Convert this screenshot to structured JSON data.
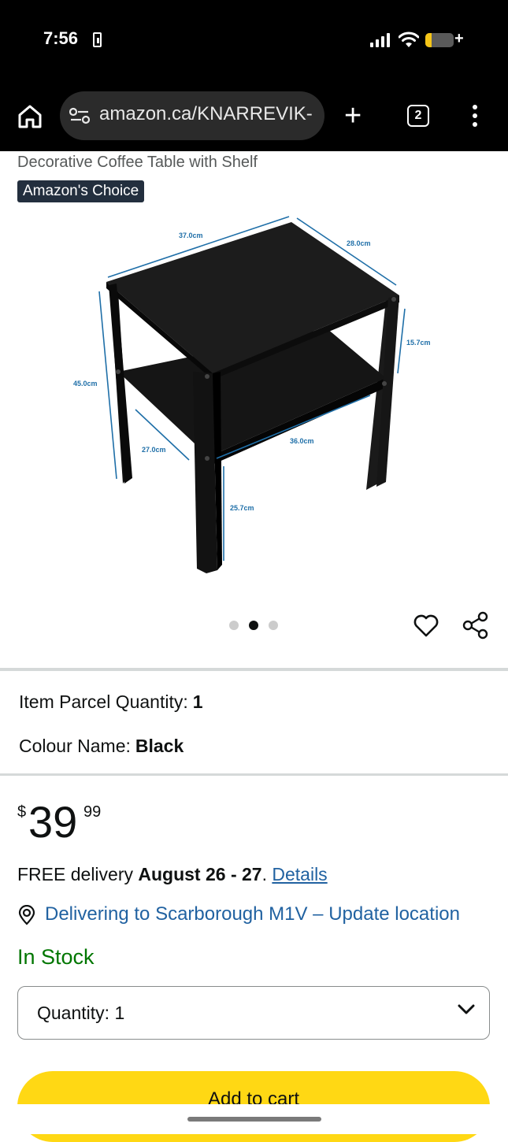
{
  "status_bar": {
    "time": "7:56",
    "battery_level": 0.22
  },
  "browser": {
    "url": "amazon.ca/KNARREVIK-",
    "tab_count": "2",
    "icons": [
      "home-icon",
      "site-settings-icon",
      "new-tab-icon",
      "tabs-icon",
      "more-menu-icon"
    ]
  },
  "product": {
    "title_fragment": "Decorative Coffee Table with Shelf",
    "badge": "Amazon's Choice",
    "image": {
      "dimensions": {
        "top_width": "37.0cm",
        "top_depth": "28.0cm",
        "shelf_gap": "15.7cm",
        "height": "45.0cm",
        "shelf_depth": "27.0cm",
        "shelf_width": "36.0cm",
        "leg_clearance": "25.7cm"
      }
    },
    "carousel": {
      "count": 3,
      "active_index": 1
    }
  },
  "attributes": [
    {
      "label": "Item Parcel Quantity:",
      "value": "1"
    },
    {
      "label": "Colour Name:",
      "value": "Black"
    }
  ],
  "price": {
    "symbol": "$",
    "whole": "39",
    "fraction": "99"
  },
  "delivery": {
    "prefix": "FREE delivery",
    "dates": "August 26 - 27",
    "suffix": ".",
    "details_link": "Details"
  },
  "location": {
    "text": "Delivering to Scarborough M1V – Update location"
  },
  "stock": {
    "text": "In Stock",
    "color": "#007600"
  },
  "quantity": {
    "label": "Quantity:",
    "value": "1"
  },
  "cart": {
    "label": "Add to cart",
    "color": "#ffd814"
  },
  "colors": {
    "link": "#2162a1",
    "badge_bg": "#232f3e"
  }
}
